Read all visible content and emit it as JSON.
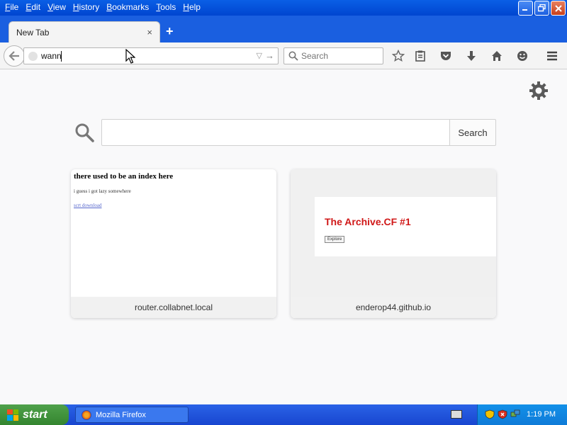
{
  "menu": [
    "File",
    "Edit",
    "View",
    "History",
    "Bookmarks",
    "Tools",
    "Help"
  ],
  "window_buttons": [
    "minimize",
    "restore",
    "close"
  ],
  "tab": {
    "title": "New Tab",
    "close": "×"
  },
  "new_tab_symbol": "+",
  "urlbar": {
    "value": "wann"
  },
  "searchbar": {
    "placeholder": "Search"
  },
  "content_search": {
    "button": "Search"
  },
  "tiles": [
    {
      "caption": "router.collabnet.local",
      "thumb_heading": "there used to be an index here",
      "thumb_text": "i guess i got lazy somewhere",
      "thumb_link": "scrt download"
    },
    {
      "caption": "enderop44.github.io",
      "thumb_title": "The Archive.CF #1",
      "thumb_button": "Explore"
    }
  ],
  "taskbar": {
    "start": "start",
    "window": "Mozilla Firefox",
    "clock": "1:19 PM"
  },
  "colors": {
    "titlebar": "#0a5fe6",
    "archive_title": "#d01818",
    "start_green": "#3c8f37"
  }
}
